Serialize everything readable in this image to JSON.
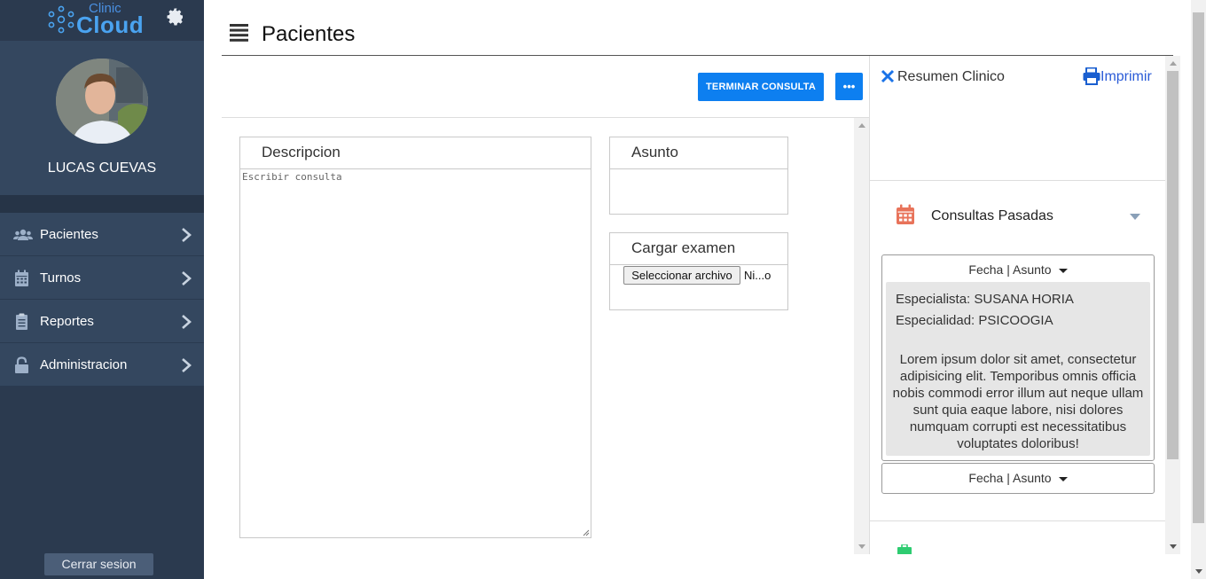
{
  "brand": {
    "small": "Clinic",
    "big": "Cloud"
  },
  "user": {
    "name": "LUCAS CUEVAS"
  },
  "sidebar": {
    "items": [
      {
        "label": "Pacientes",
        "icon": "users-icon"
      },
      {
        "label": "Turnos",
        "icon": "calendar-icon"
      },
      {
        "label": "Reportes",
        "icon": "clipboard-icon"
      },
      {
        "label": "Administracion",
        "icon": "lock-icon"
      }
    ],
    "logout_label": "Cerrar sesion"
  },
  "header": {
    "title": "Pacientes"
  },
  "toolbar": {
    "finish_label": "TERMINAR CONSULTA",
    "more_label": "•••"
  },
  "form": {
    "description": {
      "title": "Descripcion",
      "placeholder": "Escribir consulta"
    },
    "subject": {
      "title": "Asunto"
    },
    "exam": {
      "title": "Cargar examen",
      "button_label": "Seleccionar archivo",
      "file_name": "Ni...o"
    }
  },
  "summary": {
    "title": "Resumen Clinico",
    "print_label": "Imprimir",
    "past": {
      "title": "Consultas Pasadas",
      "cards": [
        {
          "header": "Fecha | Asunto",
          "specialist": "Especialista: SUSANA HORIA",
          "specialty": "Especialidad: PSICOOGIA",
          "text": "Lorem ipsum dolor sit amet, consectetur adipisicing elit. Temporibus omnis officia nobis commodi error illum aut neque ullam sunt quia eaque labore, nisi dolores numquam corrupti est necessitatibus voluptates doloribus!"
        },
        {
          "header": "Fecha | Asunto"
        }
      ]
    }
  },
  "colors": {
    "sidebar": "#2b3a4f",
    "accent": "#0d7ff0",
    "link": "#2a5bd7",
    "calendar": "#e8735a"
  }
}
